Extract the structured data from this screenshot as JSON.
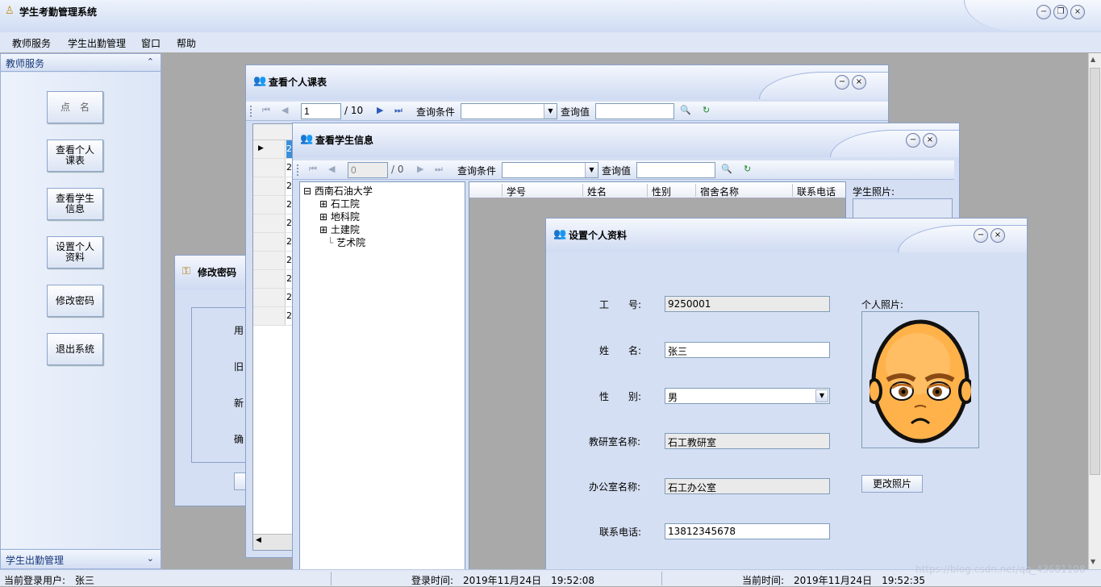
{
  "app": {
    "title": "学生考勤管理系统"
  },
  "menu": [
    "教师服务",
    "学生出勤管理",
    "窗口",
    "帮助"
  ],
  "sidebar": {
    "header": "教师服务",
    "buttons": [
      "点　名",
      "查看个人\n课表",
      "查看学生\n信息",
      "设置个人\n资料",
      "修改密码",
      "退出系统"
    ],
    "footer": "学生出勤管理"
  },
  "schedule_window": {
    "title": "查看个人课表",
    "page_input": "1",
    "page_total": "/ 10",
    "condition_label": "查询条件",
    "value_label": "查询值",
    "row_cells": [
      "2",
      "2",
      "2",
      "2",
      "2",
      "2",
      "2",
      "2",
      "2",
      "2"
    ]
  },
  "password_window": {
    "title": "修改密码",
    "labels": [
      "用",
      "旧",
      "新",
      "确"
    ]
  },
  "student_window": {
    "title": "查看学生信息",
    "page_input": "0",
    "page_total": "/ 0",
    "condition_label": "查询条件",
    "value_label": "查询值",
    "tree": {
      "root": "西南石油大学",
      "children": [
        "石工院",
        "地科院",
        "土建院",
        "艺术院"
      ]
    },
    "columns": [
      "学号",
      "姓名",
      "性别",
      "宿舍名称",
      "联系电话"
    ],
    "photo_label": "学生照片:"
  },
  "profile_window": {
    "title": "设置个人资料",
    "fields": {
      "id_label": "工　　号:",
      "id_value": "9250001",
      "name_label": "姓　　名:",
      "name_value": "张三",
      "gender_label": "性　　别:",
      "gender_value": "男",
      "dept_label": "教研室名称:",
      "dept_value": "石工教研室",
      "office_label": "办公室名称:",
      "office_value": "石工办公室",
      "phone_label": "联系电话:",
      "phone_value": "13812345678"
    },
    "photo_label": "个人照片:",
    "change_photo_button": "更改照片"
  },
  "status": {
    "user": "当前登录用户:　张三",
    "login_time": "登录时间:　2019年11月24日　19:52:08",
    "current_time": "当前时间:　2019年11月24日　19:52:35"
  },
  "watermark": "https://blog.csdn.net/qq_43681108",
  "colors": {
    "accent": "#16387a",
    "window_bg": "#d5dff3",
    "desktop": "#a9a9a9",
    "selected_row": "#3b8ed9"
  }
}
